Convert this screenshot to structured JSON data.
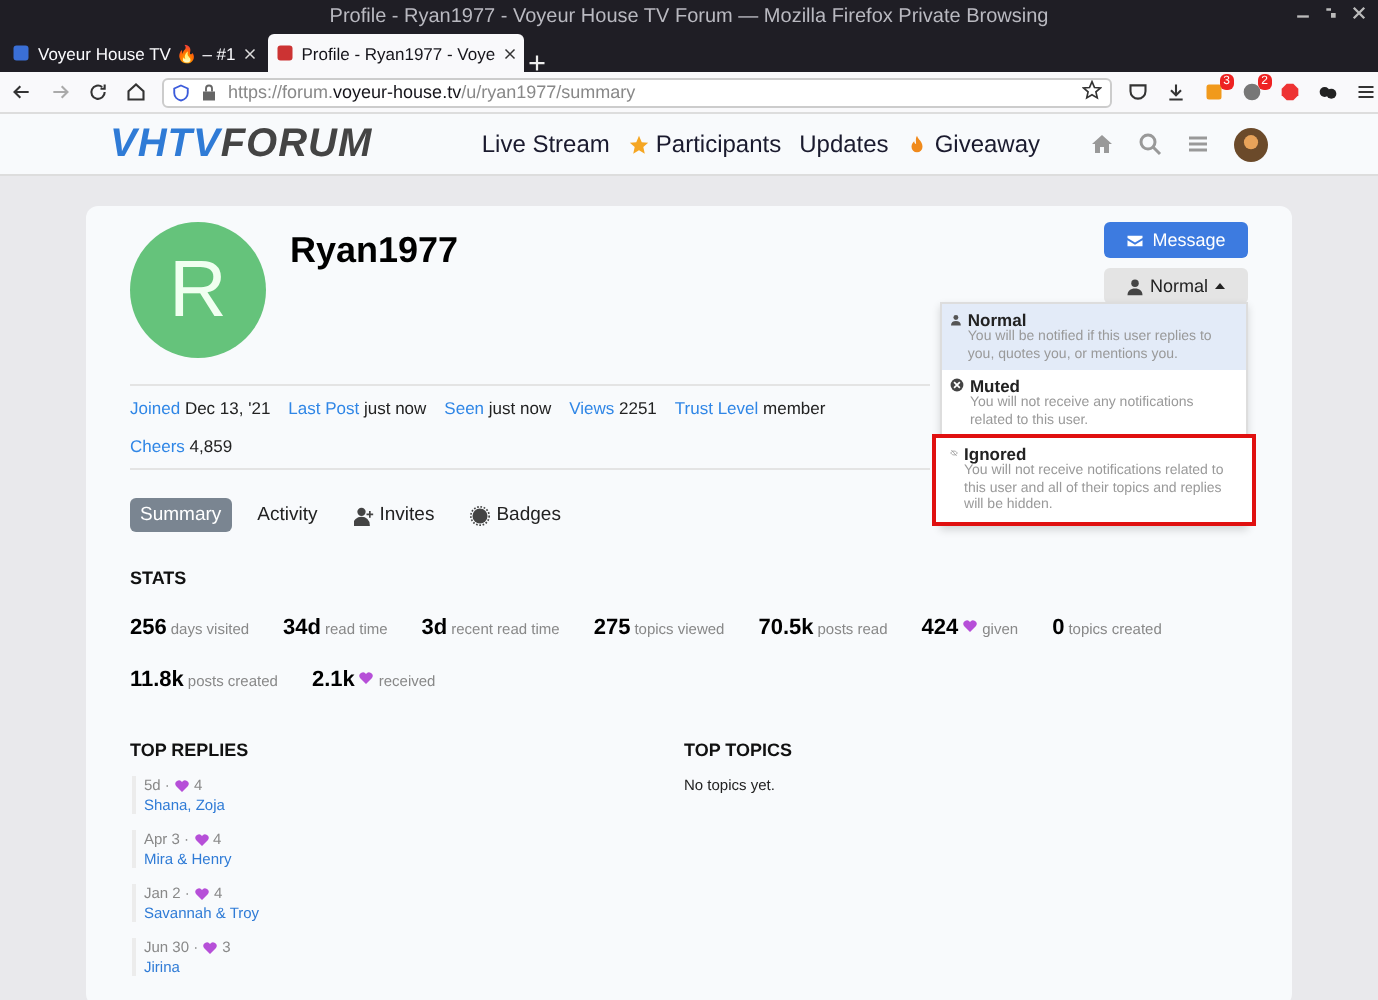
{
  "window": {
    "title": "Profile - Ryan1977 - Voyeur House TV Forum — Mozilla Firefox Private Browsing"
  },
  "browser_tabs": [
    {
      "label": "Voyeur House TV 🔥 – #1",
      "selected": false
    },
    {
      "label": "Profile - Ryan1977 - Voye",
      "selected": true
    }
  ],
  "address_bar": {
    "prefix": "https://forum.",
    "domain": "voyeur-house.tv",
    "path": "/u/ryan1977/summary"
  },
  "toolbar_badges": [
    "3",
    "2"
  ],
  "site_header": {
    "logo_left": "VHTV",
    "logo_right": "FORUM",
    "nav": [
      {
        "label": "Live Stream",
        "kind": "plain"
      },
      {
        "label": "Participants",
        "kind": "star"
      },
      {
        "label": "Updates",
        "kind": "plain"
      },
      {
        "label": "Giveaway",
        "kind": "fire"
      }
    ]
  },
  "profile": {
    "initial": "R",
    "username": "Ryan1977",
    "message_button": "Message",
    "notification_button": "Normal",
    "meta": [
      {
        "label": "Joined",
        "value": "Dec 13, '21"
      },
      {
        "label": "Last Post",
        "value": "just now"
      },
      {
        "label": "Seen",
        "value": "just now"
      },
      {
        "label": "Views",
        "value": "2251"
      },
      {
        "label": "Trust Level",
        "value": "member"
      }
    ],
    "meta_2": [
      {
        "label": "Cheers",
        "value": "4,859"
      }
    ],
    "notification_menu": [
      {
        "kind": "user",
        "title": "Normal",
        "description": "You will be notified if this user replies to you, quotes you, or mentions you.",
        "selected": true,
        "highlighted": false
      },
      {
        "kind": "muted",
        "title": "Muted",
        "description": "You will not receive any notifications related to this user.",
        "selected": false,
        "highlighted": false
      },
      {
        "kind": "ignored",
        "title": "Ignored",
        "description": "You will not receive notifications related to this user and all of their topics and replies will be hidden.",
        "selected": false,
        "highlighted": true
      }
    ]
  },
  "profile_tabs": [
    {
      "label": "Summary",
      "kind": "plain",
      "selected": true
    },
    {
      "label": "Activity",
      "kind": "plain",
      "selected": false
    },
    {
      "label": "Invites",
      "kind": "invite",
      "selected": false
    },
    {
      "label": "Badges",
      "kind": "badge",
      "selected": false
    }
  ],
  "stats": {
    "heading": "STATS",
    "rows": [
      [
        {
          "value": "256",
          "label": "days visited",
          "heart": false
        },
        {
          "value": "34d",
          "label": "read time",
          "heart": false
        },
        {
          "value": "3d",
          "label": "recent read time",
          "heart": false
        },
        {
          "value": "275",
          "label": "topics viewed",
          "heart": false
        },
        {
          "value": "70.5k",
          "label": "posts read",
          "heart": false
        },
        {
          "value": "424",
          "label": "given",
          "heart": true
        },
        {
          "value": "0",
          "label": "topics created",
          "heart": false
        }
      ],
      [
        {
          "value": "11.8k",
          "label": "posts created",
          "heart": false
        },
        {
          "value": "2.1k",
          "label": "received",
          "heart": true
        }
      ]
    ]
  },
  "top_replies": {
    "heading": "TOP REPLIES",
    "items": [
      {
        "date": "5d ·",
        "likes": "4",
        "title": "Shana, Zoja"
      },
      {
        "date": "Apr 3 ·",
        "likes": "4",
        "title": "Mira & Henry"
      },
      {
        "date": "Jan 2 ·",
        "likes": "4",
        "title": "Savannah & Troy"
      },
      {
        "date": "Jun 30 ·",
        "likes": "3",
        "title": "Jirina"
      }
    ]
  },
  "top_topics": {
    "heading": "TOP TOPICS",
    "empty": "No topics yet."
  }
}
